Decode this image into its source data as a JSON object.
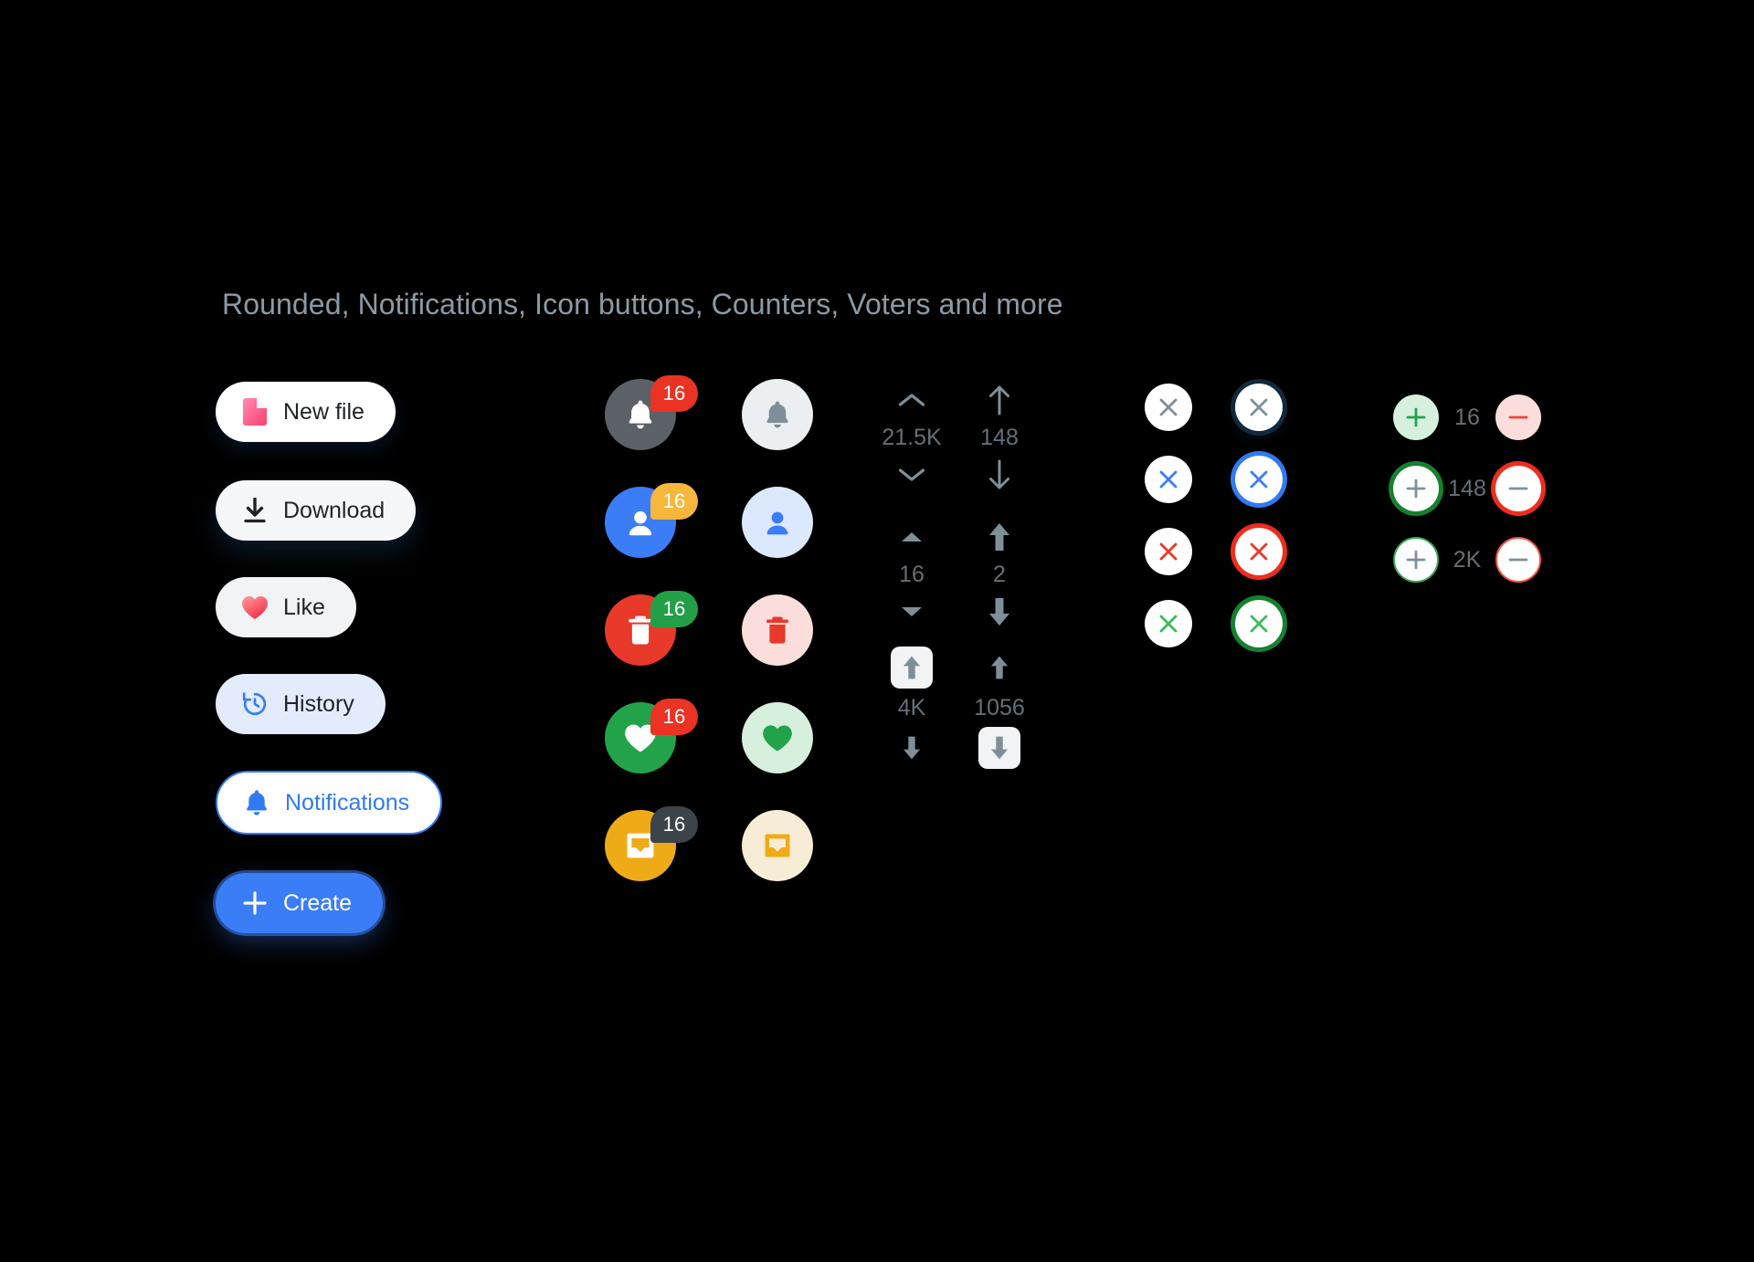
{
  "heading": "Rounded, Notifications, Icon buttons, Counters, Voters and more",
  "pill_buttons": [
    {
      "label": "New file",
      "icon": "file-icon",
      "style": "p-newfile"
    },
    {
      "label": "Download",
      "icon": "download-icon",
      "style": "p-download"
    },
    {
      "label": "Like",
      "icon": "heart-icon",
      "style": "p-like"
    },
    {
      "label": "History",
      "icon": "history-icon",
      "style": "p-history"
    },
    {
      "label": "Notifications",
      "icon": "bell-icon",
      "style": "p-notifications"
    },
    {
      "label": "Create",
      "icon": "plus-icon",
      "style": "p-create"
    }
  ],
  "notifications": [
    {
      "icon": "bell-icon",
      "badge": "16",
      "solid_bg": "#5b6166",
      "badge_bg": "#ea3323",
      "soft_bg": "#eceff1",
      "soft_fg": "#7e8f99"
    },
    {
      "icon": "person-icon",
      "badge": "16",
      "solid_bg": "#3b7df6",
      "badge_bg": "#f6b73c",
      "soft_bg": "#dce8fd",
      "soft_fg": "#3b7df6"
    },
    {
      "icon": "trash-icon",
      "badge": "16",
      "solid_bg": "#e8392a",
      "badge_bg": "#23a047",
      "soft_bg": "#fbdedb",
      "soft_fg": "#e8392a"
    },
    {
      "icon": "heart-icon",
      "badge": "16",
      "solid_bg": "#22a34a",
      "badge_bg": "#ea3323",
      "soft_bg": "#d6f0dd",
      "soft_fg": "#22a34a"
    },
    {
      "icon": "inbox-icon",
      "badge": "16",
      "solid_bg": "#efab17",
      "badge_bg": "#3c444a",
      "soft_bg": "#f7ecd6",
      "soft_fg": "#efab17"
    }
  ],
  "voters": [
    {
      "value": "21.5K",
      "up_icon": "chevron-up-icon",
      "down_icon": "chevron-down-icon",
      "boxed_up": false,
      "boxed_down": false
    },
    {
      "value": "148",
      "up_icon": "arrow-up-icon",
      "down_icon": "arrow-down-icon",
      "boxed_up": false,
      "boxed_down": false
    },
    {
      "value": "16",
      "up_icon": "caret-up-icon",
      "down_icon": "caret-down-icon",
      "boxed_up": false,
      "boxed_down": false
    },
    {
      "value": "2",
      "up_icon": "fat-arrow-up-icon",
      "down_icon": "fat-arrow-down-icon",
      "boxed_up": false,
      "boxed_down": false
    },
    {
      "value": "4K",
      "up_icon": "fat-arrow-up-icon",
      "down_icon": "fat-arrow-down-icon",
      "boxed_up": true,
      "boxed_down": false
    },
    {
      "value": "1056",
      "up_icon": "fat-arrow-up-icon",
      "down_icon": "fat-arrow-down-icon",
      "boxed_up": false,
      "boxed_down": true
    }
  ],
  "close_buttons": [
    {
      "x_color": "#7e8f99",
      "ring": "none",
      "ring_color": "#0f2231"
    },
    {
      "x_color": "#7e8f99",
      "ring": "shadow",
      "ring_color": "#12293b"
    },
    {
      "x_color": "#3b7df6",
      "ring": "none",
      "ring_color": "#3b7df6"
    },
    {
      "x_color": "#3b7df6",
      "ring": "solid",
      "ring_color": "#2f7af5"
    },
    {
      "x_color": "#e8392a",
      "ring": "none",
      "ring_color": "#e8392a"
    },
    {
      "x_color": "#e8392a",
      "ring": "solid",
      "ring_color": "#ef2d1c"
    },
    {
      "x_color": "#3cbb5e",
      "ring": "none",
      "ring_color": "#23a047"
    },
    {
      "x_color": "#3cbb5e",
      "ring": "solid",
      "ring_color": "#15812f"
    }
  ],
  "counters": [
    {
      "value": "16",
      "plus_bg": "#d6f0dd",
      "plus_fg": "#22a34a",
      "plus_border": "none",
      "minus_bg": "#fbdedb",
      "minus_fg": "#ef4437",
      "minus_border": "none"
    },
    {
      "value": "148",
      "plus_bg": "#ffffff",
      "plus_fg": "#7e8f99",
      "plus_border": "#15812f",
      "minus_bg": "#ffffff",
      "minus_fg": "#7e8f99",
      "minus_border": "#ef2d1c"
    },
    {
      "value": "2K",
      "plus_bg": "#ffffff",
      "plus_fg": "#7e8f99",
      "plus_border": "#35a75a",
      "minus_bg": "#ffffff",
      "minus_fg": "#7e8f99",
      "minus_border": "#f4543f"
    }
  ],
  "colors": {
    "background": "#000000",
    "heading_text": "#8b9aa6",
    "accent_blue": "#3b7df6",
    "muted_text": "#646f78"
  }
}
